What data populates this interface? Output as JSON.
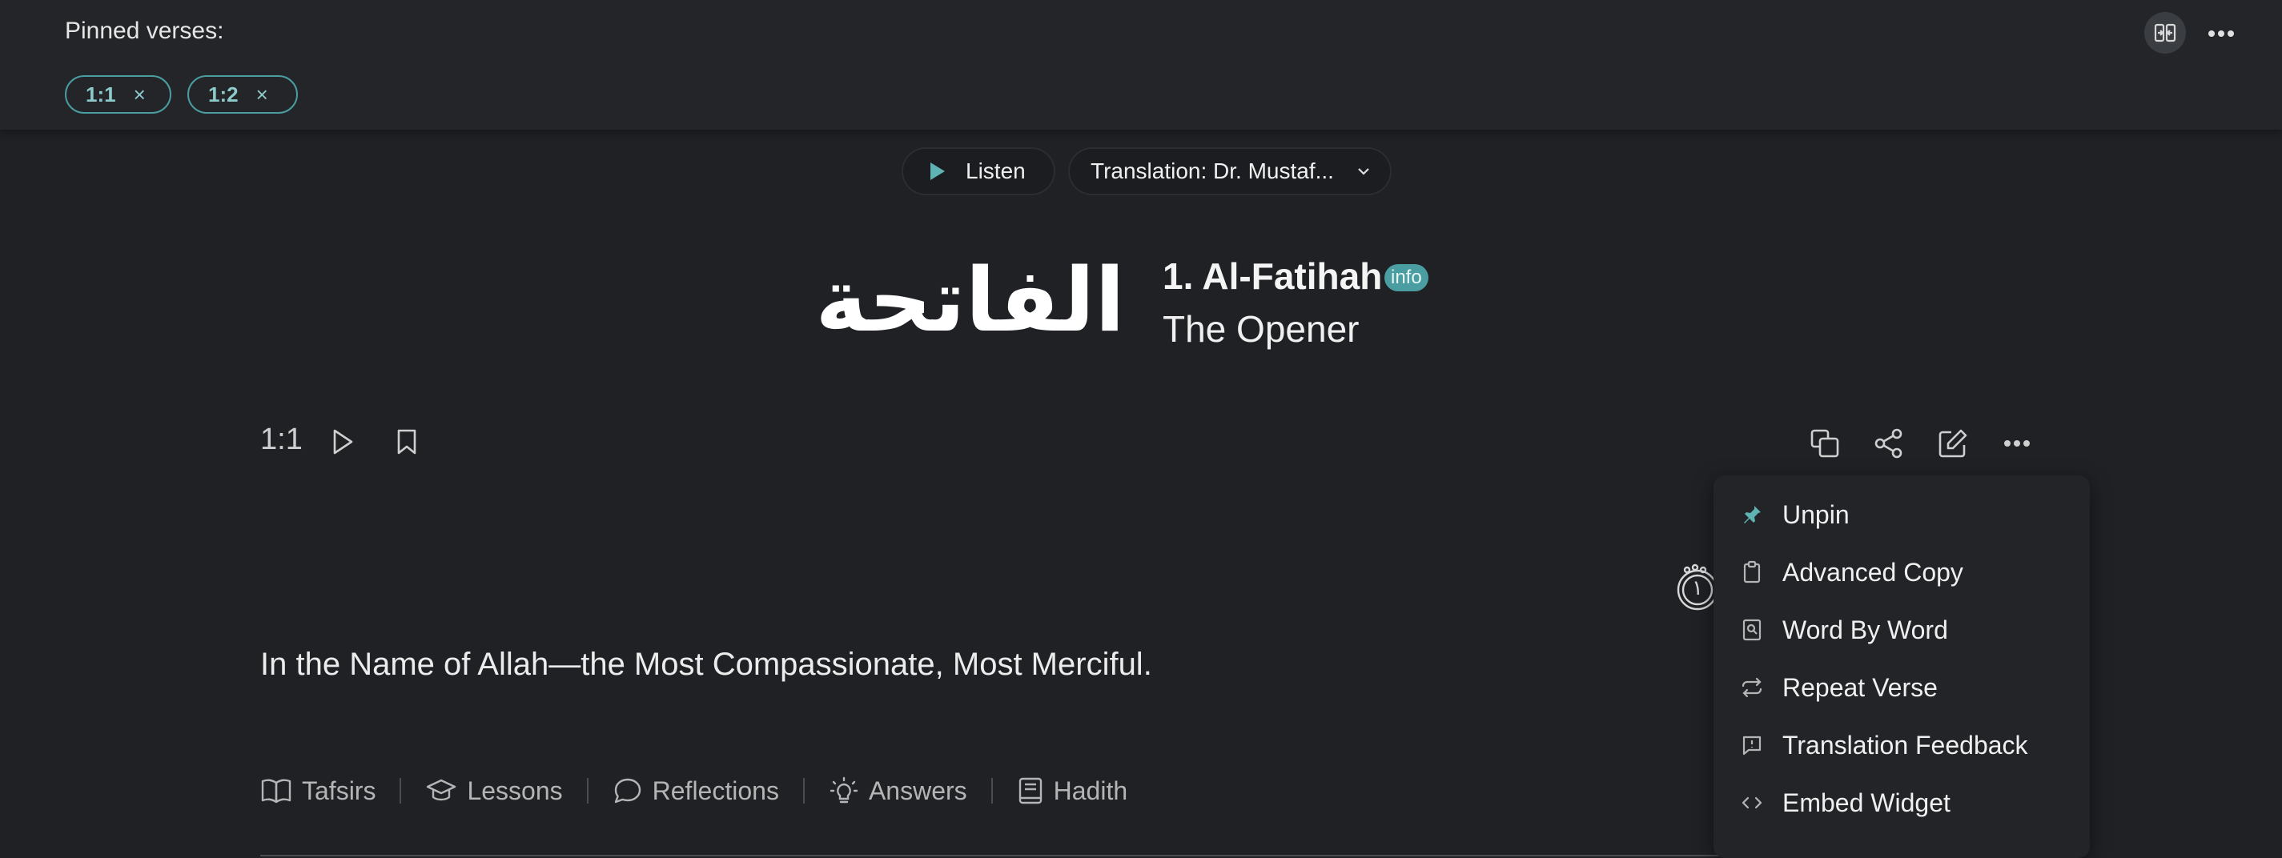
{
  "pinned": {
    "label": "Pinned verses:",
    "chips": [
      {
        "label": "1:1",
        "close": "×"
      },
      {
        "label": "1:2",
        "close": "×"
      }
    ]
  },
  "toolbar": {
    "listen": "Listen",
    "translation": "Translation: Dr. Mustaf..."
  },
  "surah": {
    "calligraphy": "الفاتحة",
    "name": "1. Al-Fatihah",
    "info": "info",
    "subtitle": "The Opener"
  },
  "verse": {
    "key": "1:1",
    "arabic_fragment": "١",
    "translation": "In the Name of Allah—the Most Compassionate, Most Merciful."
  },
  "footer_tabs": [
    "Tafsirs",
    "Lessons",
    "Reflections",
    "Answers",
    "Hadith"
  ],
  "menu": {
    "items": [
      {
        "label": "Unpin",
        "icon": "pin-icon"
      },
      {
        "label": "Advanced Copy",
        "icon": "clipboard-icon"
      },
      {
        "label": "Word By Word",
        "icon": "word-by-word-icon"
      },
      {
        "label": "Repeat Verse",
        "icon": "repeat-icon"
      },
      {
        "label": "Translation Feedback",
        "icon": "feedback-icon"
      },
      {
        "label": "Embed Widget",
        "icon": "code-icon"
      }
    ]
  },
  "colors": {
    "background": "#1f2125",
    "accent": "#4a9da0",
    "text": "#e8e8e8"
  }
}
